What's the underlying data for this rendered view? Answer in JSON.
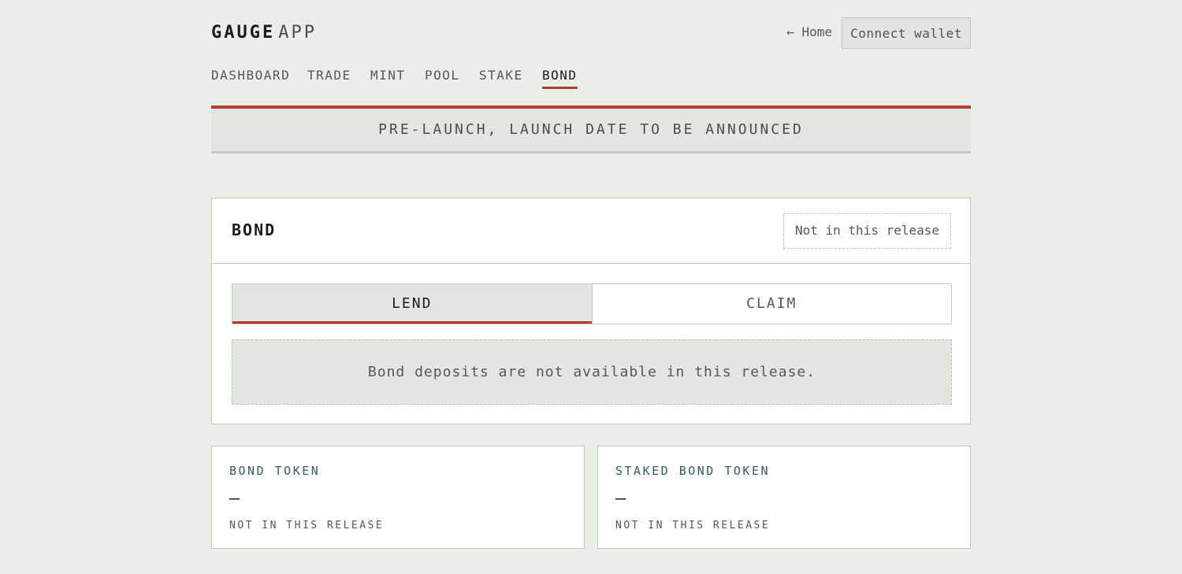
{
  "header": {
    "brand_primary": "GAUGE",
    "brand_secondary": "APP",
    "home_link": "← Home",
    "connect_wallet": "Connect wallet"
  },
  "nav": {
    "items": [
      {
        "label": "DASHBOARD",
        "active": false
      },
      {
        "label": "TRADE",
        "active": false
      },
      {
        "label": "MINT",
        "active": false
      },
      {
        "label": "POOL",
        "active": false
      },
      {
        "label": "STAKE",
        "active": false
      },
      {
        "label": "BOND",
        "active": true
      }
    ]
  },
  "banner": {
    "text": "PRE-LAUNCH, LAUNCH DATE TO BE ANNOUNCED"
  },
  "bond_card": {
    "title": "BOND",
    "release_tag": "Not in this release",
    "tabs": [
      {
        "label": "LEND",
        "active": true
      },
      {
        "label": "CLAIM",
        "active": false
      }
    ],
    "notice": "Bond deposits are not available in this release."
  },
  "tokens": [
    {
      "label": "BOND TOKEN",
      "value": "—",
      "status": "NOT IN THIS RELEASE"
    },
    {
      "label": "STAKED BOND TOKEN",
      "value": "—",
      "status": "NOT IN THIS RELEASE"
    }
  ],
  "colors": {
    "background": "#ebede7",
    "accent_red": "#b83a2e",
    "token_label_teal": "#2f5d6b"
  }
}
